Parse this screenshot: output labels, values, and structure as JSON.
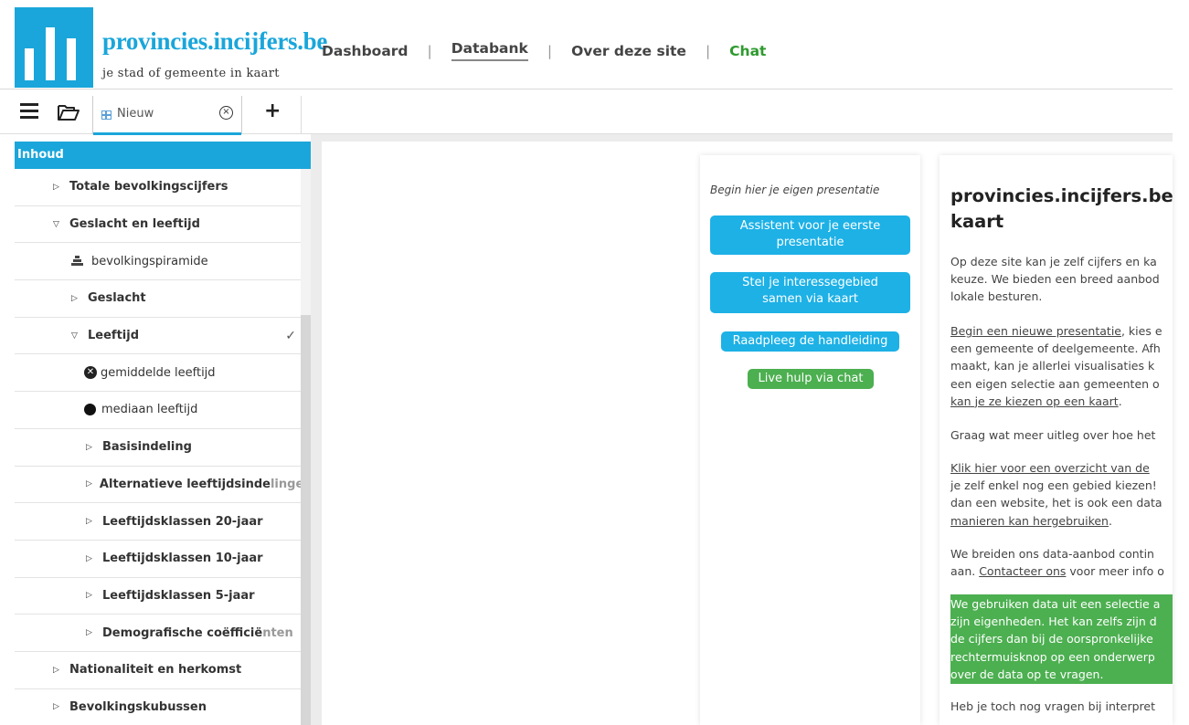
{
  "header": {
    "brand_title": "provincies.incijfers.be",
    "brand_subtitle": "je stad of gemeente in kaart",
    "nav": [
      {
        "label": "Dashboard"
      },
      {
        "label": "Databank"
      },
      {
        "label": "Over deze site"
      },
      {
        "label": "Chat"
      }
    ],
    "nav_separator": "|",
    "brand_color": "#1aa6da",
    "chat_color": "#2e9a2e"
  },
  "tabbar": {
    "tab_label": "Nieuw",
    "close_glyph": "×",
    "add_glyph": "+"
  },
  "sidebar": {
    "heading": "Inhoud",
    "items": [
      {
        "label": "Totale bevolkingscijfers",
        "caret": "▷"
      },
      {
        "label": "Geslacht en leeftijd",
        "caret": "▽"
      },
      {
        "label": "bevolkingspiramide",
        "icon": "pyramid-icon"
      },
      {
        "label": "Geslacht",
        "caret": "▷"
      },
      {
        "label": "Leeftijd",
        "caret": "▽",
        "check": "✓"
      },
      {
        "label": "gemiddelde leeftijd",
        "icon": "x-circle-icon",
        "icon_glyph": "✕"
      },
      {
        "label": "mediaan leeftijd",
        "icon": "dot-icon"
      },
      {
        "label": "Basisindeling",
        "caret": "▷"
      },
      {
        "label": "Alternatieve leeftijdsinde",
        "label_fade": "lingen",
        "caret": "▷"
      },
      {
        "label": "Leeftijdsklassen 20-jaar",
        "caret": "▷"
      },
      {
        "label": "Leeftijdsklassen 10-jaar",
        "caret": "▷"
      },
      {
        "label": "Leeftijdsklassen 5-jaar",
        "caret": "▷"
      },
      {
        "label": "Demografische coëfficië",
        "label_fade": "nten",
        "caret": "▷"
      },
      {
        "label": "Nationaliteit en herkomst",
        "caret": "▷"
      },
      {
        "label": "Bevolkingskubussen",
        "caret": "▷"
      }
    ]
  },
  "start_panel": {
    "intro": "Begin hier je eigen presentatie",
    "buttons": [
      {
        "line1": "Assistent voor je eerste",
        "line2": "presentatie"
      },
      {
        "line1": "Stel je interessegebied",
        "line2": "samen via kaart"
      },
      {
        "line1": "Raadpleeg de handleiding"
      },
      {
        "line1": "Live hulp via chat"
      }
    ]
  },
  "info_panel": {
    "title_line1": "provincies.incijfers.be - j",
    "title_line2": "kaart",
    "p1": [
      "Op deze site kan je zelf cijfers en ka",
      "keuze. We bieden een breed aanbod",
      "lokale besturen."
    ],
    "p2_link": "Begin een nieuwe presentatie",
    "p2_rest": ", kies e",
    "p2": [
      "een gemeente of deelgemeente. Afh",
      "maakt, kan je allerlei visualisaties k",
      "een eigen selectie aan gemeenten o"
    ],
    "p2_last_link": "kan je ze kiezen op een kaart",
    "p2_last_rest": ".",
    "p3": "Graag wat meer uitleg over hoe het",
    "p4_link": "Klik hier voor een overzicht van de",
    "p4": [
      "je zelf enkel nog een gebied kiezen!",
      "dan een website, het is ook een data"
    ],
    "p4_last_link": "manieren kan hergebruiken",
    "p4_last_rest": ".",
    "p5_line1": "We breiden ons data-aanbod contin",
    "p5_pre": "aan. ",
    "p5_link": "Contacteer ons",
    "p5_rest": " voor meer info o",
    "green": [
      "We gebruiken data uit een selectie a",
      "zijn eigenheden. Het kan zelfs zijn d",
      "de cijfers dan bij de oorspronkelijke",
      "rechtermuisknop op een onderwerp",
      "over de data op te vragen."
    ],
    "last": "Heb je toch nog vragen bij interpret"
  }
}
